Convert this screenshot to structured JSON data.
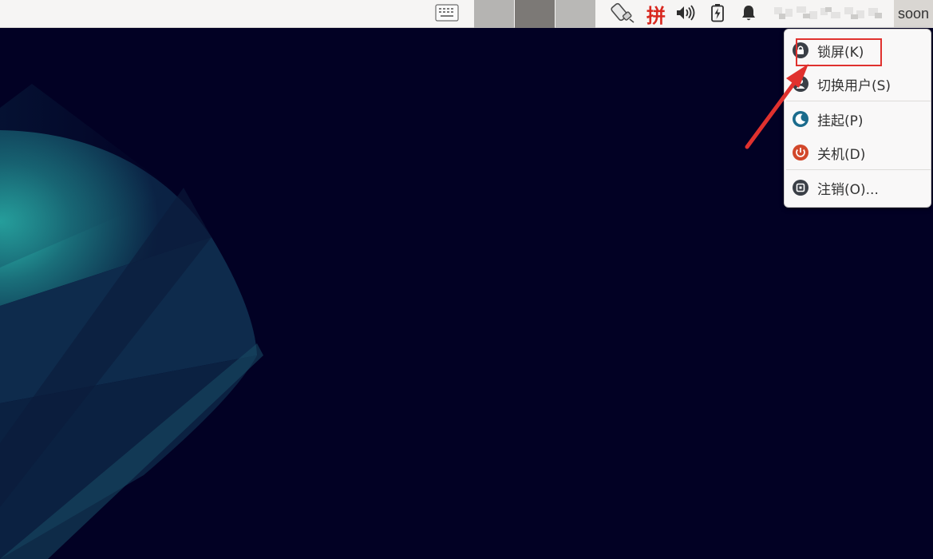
{
  "top_panel": {
    "ime_label": "拼",
    "username": "soon",
    "workspaces": [
      {
        "color": "#b5b4b2"
      },
      {
        "color": "#7c7976"
      },
      {
        "color": "#b9b8b6"
      }
    ]
  },
  "session_menu": {
    "items": [
      {
        "label": "锁屏(K)",
        "icon": "lock-icon",
        "icon_color": "#3a3f46"
      },
      {
        "label": "切换用户(S)",
        "icon": "switch-user-icon",
        "icon_color": "#3a3f46"
      },
      {
        "label": "挂起(P)",
        "icon": "suspend-moon-icon",
        "icon_color": "#1a6b8c"
      },
      {
        "label": "关机(D)",
        "icon": "power-icon",
        "icon_color": "#d2482b"
      },
      {
        "label": "注销(O)...",
        "icon": "logout-icon",
        "icon_color": "#3a3f46"
      }
    ]
  },
  "annotation": {
    "color": "#e0312e"
  },
  "theme": {
    "desktop_bg": "#020124",
    "wallpaper_teal": "#2ec4b6"
  }
}
